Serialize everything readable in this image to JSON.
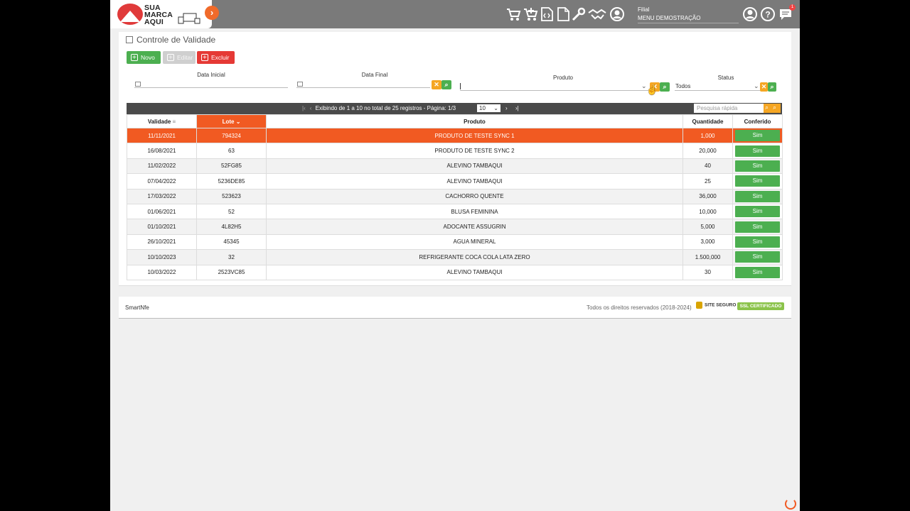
{
  "logo": {
    "line1": "SUA",
    "line2": "MARCA",
    "line3": "AQUI"
  },
  "header": {
    "filial_label": "Filial",
    "filial_value": "MENU DEMOSTRAÇÃO",
    "notification_count": "1"
  },
  "page": {
    "title": "Controle de Validade"
  },
  "toolbar": {
    "novo": "Novo",
    "editar": "Editar",
    "excluir": "Excluir"
  },
  "filters": {
    "data_inicial": "Data Inicial",
    "data_final": "Data Final",
    "produto": "Produto",
    "status": "Status",
    "status_value": "Todos"
  },
  "grid": {
    "pager_text": "Exibindo de 1 a 10 no total de 25 registros - Página: 1/3",
    "page_size": "10",
    "quick_search_placeholder": "Pesquisa rápida",
    "columns": [
      "Validade",
      "Lote",
      "Produto",
      "Quantidade",
      "Conferido"
    ],
    "rows": [
      [
        "11/11/2021",
        "794324",
        "PRODUTO DE TESTE SYNC 1",
        "1,000",
        "Sim"
      ],
      [
        "16/08/2021",
        "63",
        "PRODUTO DE TESTE SYNC 2",
        "20,000",
        "Sim"
      ],
      [
        "11/02/2022",
        "52FG85",
        "ALEVINO TAMBAQUI",
        "40",
        "Sim"
      ],
      [
        "07/04/2022",
        "5236DE85",
        "ALEVINO TAMBAQUI",
        "25",
        "Sim"
      ],
      [
        "17/03/2022",
        "523623",
        "CACHORRO QUENTE",
        "36,000",
        "Sim"
      ],
      [
        "01/06/2021",
        "52",
        "BLUSA FEMININA",
        "10,000",
        "Sim"
      ],
      [
        "01/10/2021",
        "4L82H5",
        "ADOCANTE ASSUGRIN",
        "5,000",
        "Sim"
      ],
      [
        "26/10/2021",
        "45345",
        "AGUA MINERAL",
        "3,000",
        "Sim"
      ],
      [
        "10/10/2023",
        "32",
        "REFRIGERANTE COCA COLA LATA ZERO",
        "1.500,000",
        "Sim"
      ],
      [
        "10/03/2022",
        "2523VC85",
        "ALEVINO TAMBAQUI",
        "30",
        "Sim"
      ]
    ]
  },
  "footer": {
    "brand": "SmartNfe",
    "rights": "Todos os direitos reservados (2018-2024)",
    "site_seguro": "SITE SEGURO",
    "ssl": "SSL CERTIFICADO"
  },
  "colors": {
    "accent": "#f15a22",
    "success": "#4caf50",
    "danger": "#e53935",
    "topbar": "#7a7a7a"
  }
}
